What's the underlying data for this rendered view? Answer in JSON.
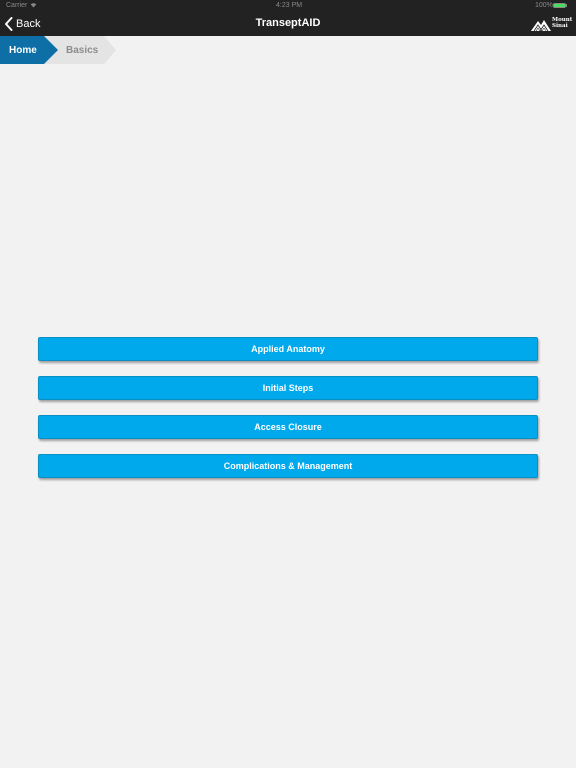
{
  "status_bar": {
    "carrier": "Carrier",
    "time": "4:23 PM",
    "battery": "100%"
  },
  "nav": {
    "back_label": "Back",
    "title": "TranseptAID",
    "logo_line1": "Mount",
    "logo_line2": "Sinai"
  },
  "breadcrumb": {
    "items": [
      {
        "label": "Home",
        "active": true
      },
      {
        "label": "Basics",
        "active": false
      }
    ]
  },
  "menu": {
    "items": [
      {
        "label": "Applied Anatomy"
      },
      {
        "label": "Initial Steps"
      },
      {
        "label": "Access Closure"
      },
      {
        "label": "Complications & Management"
      }
    ]
  },
  "colors": {
    "nav_background": "#222222",
    "breadcrumb_active": "#0e6fa6",
    "breadcrumb_inactive": "#e4e4e4",
    "button_background": "#00a9ec",
    "page_background": "#f2f2f2"
  }
}
